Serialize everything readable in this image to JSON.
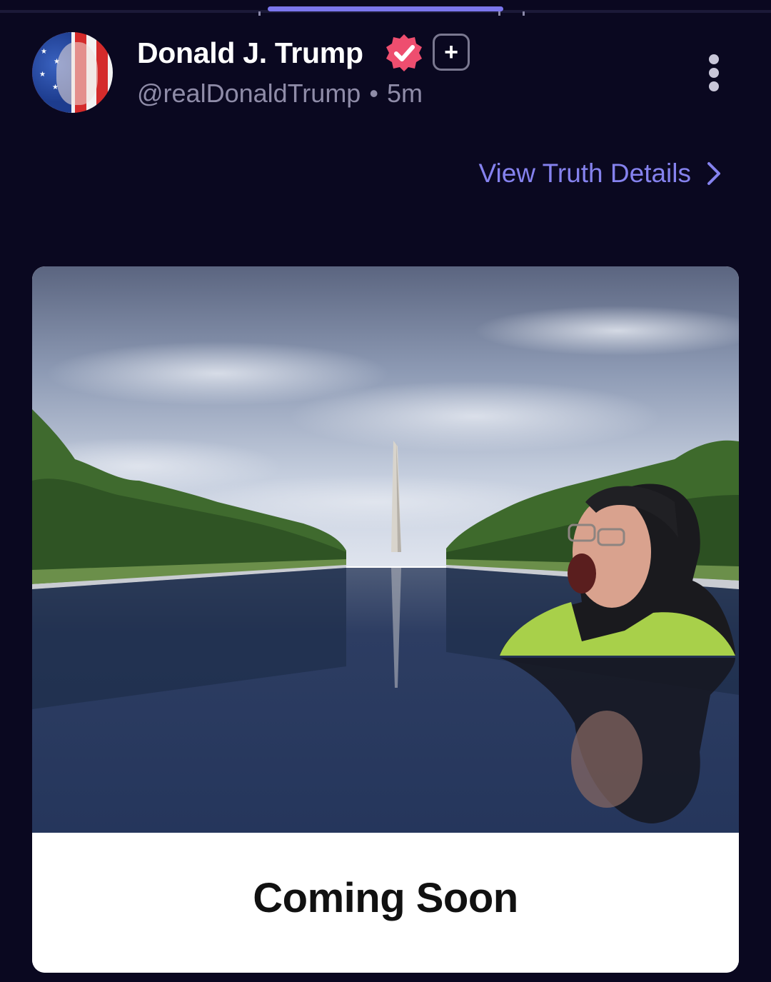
{
  "post": {
    "author_name": "Donald J. Trump",
    "handle": "@realDonaldTrump",
    "separator": "•",
    "timestamp": "5m",
    "plus_symbol": "+",
    "view_details_label": "View Truth Details"
  },
  "media": {
    "caption": "Coming Soon"
  },
  "icons": {
    "verified": "verified-badge-icon",
    "more": "more-vertical-icon",
    "chevron": "chevron-right-icon",
    "plus": "plus-icon"
  },
  "colors": {
    "background": "#0a0820",
    "accent": "#8582ee",
    "verified": "#ee4e6f",
    "muted_text": "#8f8ca8"
  }
}
